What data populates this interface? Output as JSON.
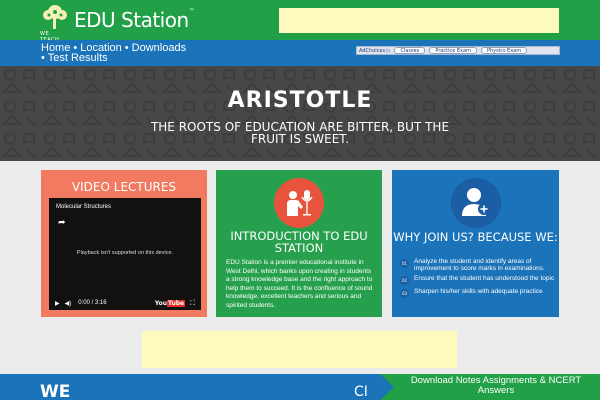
{
  "brand": {
    "name": "EDU Station",
    "trademark": "™",
    "tagline": "WE TEACH"
  },
  "nav": {
    "items": [
      "Home",
      "Location",
      "Downloads",
      "Test Results"
    ],
    "separator": "•"
  },
  "ad_bar": {
    "adchoices": "AdChoices ▷",
    "pills": [
      "Classes",
      "Practice Exam",
      "Physics Exam"
    ]
  },
  "hero": {
    "title": "ARISTOTLE",
    "quote": "THE ROOTS OF EDUCATION ARE BITTER, BUT THE FRUIT IS SWEET."
  },
  "video_card": {
    "title": "VIDEO LECTURES",
    "video_title": "Molecular Structures",
    "message": "Playback isn't supported on this device.",
    "time": "0:00 / 3:16",
    "logo": "YouTube"
  },
  "intro_card": {
    "title": "INTRODUCTION TO EDU STATION",
    "icon": "presenter-microphone-icon",
    "text": "EDU Station is a premier educational institute in West Delhi, which banks upon creating in students a strong knowledge base and the right approach to help them to succeed. It is the confluence of sound knowledge, excellent teachers and serious and spirited students."
  },
  "join_card": {
    "title": "WHY JOIN US? BECAUSE WE:",
    "icon": "add-user-icon",
    "items": [
      {
        "num": "01",
        "text": "Analyze the student and identify areas of improvement to score marks in examinations."
      },
      {
        "num": "02",
        "text": "Ensure that the student has understood the topic"
      },
      {
        "num": "03",
        "text": "Sharpen his/her skills with adequate practice"
      }
    ]
  },
  "footer": {
    "left": "WE",
    "middle": "CI",
    "right": "Download Notes Assignments & NCERT Answers"
  },
  "colors": {
    "green": "#22a047",
    "blue": "#1b73b9",
    "coral": "#f17a61",
    "ad_yellow": "#fffbbf"
  }
}
